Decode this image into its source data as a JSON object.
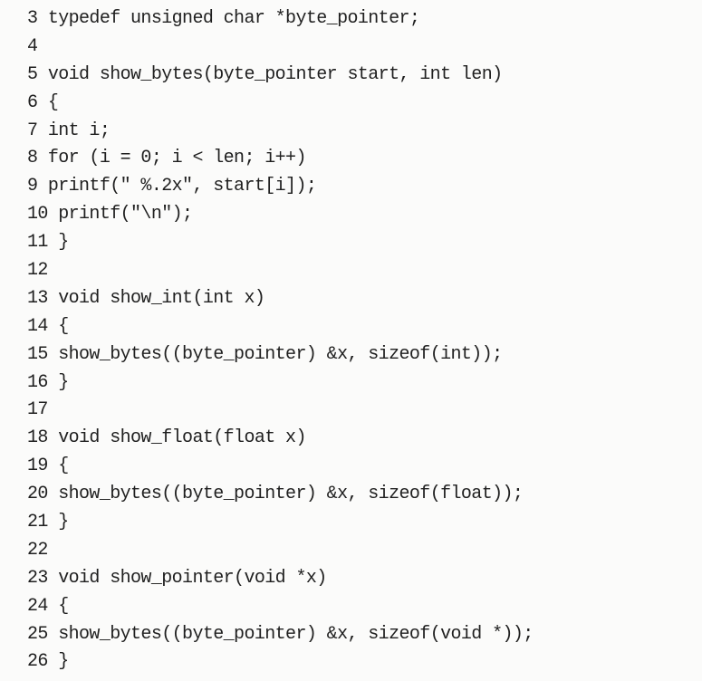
{
  "code": {
    "lines": [
      {
        "number": "3",
        "text": "typedef unsigned char *byte_pointer;"
      },
      {
        "number": "4",
        "text": ""
      },
      {
        "number": "5",
        "text": "void show_bytes(byte_pointer start, int len)"
      },
      {
        "number": "6",
        "text": "{"
      },
      {
        "number": "7",
        "text": "int i;"
      },
      {
        "number": "8",
        "text": "for (i = 0; i < len; i++)"
      },
      {
        "number": "9",
        "text": "printf(\" %.2x\", start[i]);"
      },
      {
        "number": "10",
        "text": "printf(\"\\n\");"
      },
      {
        "number": "11",
        "text": "}"
      },
      {
        "number": "12",
        "text": ""
      },
      {
        "number": "13",
        "text": "void show_int(int x)"
      },
      {
        "number": "14",
        "text": "{"
      },
      {
        "number": "15",
        "text": "show_bytes((byte_pointer) &x, sizeof(int));"
      },
      {
        "number": "16",
        "text": "}"
      },
      {
        "number": "17",
        "text": ""
      },
      {
        "number": "18",
        "text": "void show_float(float x)"
      },
      {
        "number": "19",
        "text": "{"
      },
      {
        "number": "20",
        "text": "show_bytes((byte_pointer) &x, sizeof(float));"
      },
      {
        "number": "21",
        "text": "}"
      },
      {
        "number": "22",
        "text": ""
      },
      {
        "number": "23",
        "text": "void show_pointer(void *x)"
      },
      {
        "number": "24",
        "text": "{"
      },
      {
        "number": "25",
        "text": "show_bytes((byte_pointer) &x, sizeof(void *));"
      },
      {
        "number": "26",
        "text": "}"
      }
    ]
  }
}
